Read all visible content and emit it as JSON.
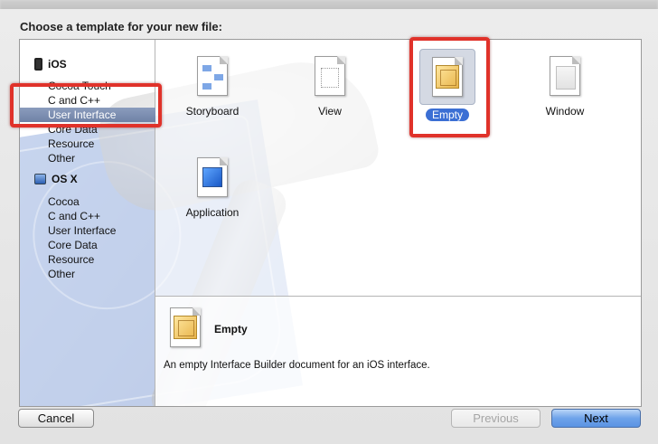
{
  "dialog": {
    "heading": "Choose a template for your new file:"
  },
  "sidebar": {
    "sections": [
      {
        "name": "iOS",
        "icon": "iphone-icon",
        "items": [
          "Cocoa Touch",
          "C and C++",
          "User Interface",
          "Core Data",
          "Resource",
          "Other"
        ]
      },
      {
        "name": "OS X",
        "icon": "mac-icon",
        "items": [
          "Cocoa",
          "C and C++",
          "User Interface",
          "Core Data",
          "Resource",
          "Other"
        ]
      }
    ],
    "selected": "User Interface"
  },
  "templates": [
    {
      "label": "Storyboard",
      "icon": "storyboard-icon"
    },
    {
      "label": "View",
      "icon": "view-icon"
    },
    {
      "label": "Empty",
      "icon": "empty-cube-icon",
      "selected": true
    },
    {
      "label": "Window",
      "icon": "window-icon"
    },
    {
      "label": "Application",
      "icon": "application-icon"
    }
  ],
  "description": {
    "title": "Empty",
    "text": "An empty Interface Builder document for an iOS interface."
  },
  "buttons": {
    "cancel": "Cancel",
    "previous": "Previous",
    "next": "Next"
  },
  "colors": {
    "highlight": "#e0322a",
    "selection": "#3b6fd4"
  }
}
